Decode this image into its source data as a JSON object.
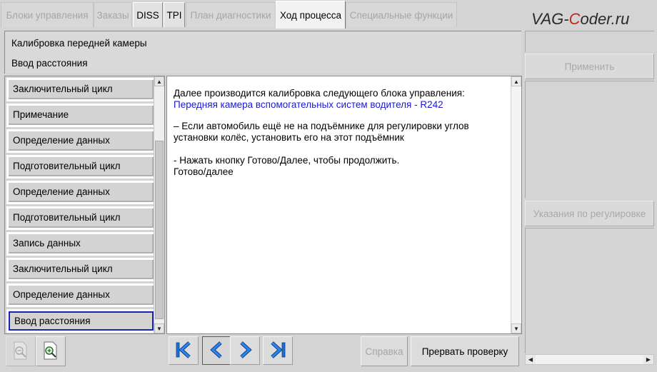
{
  "tabs": [
    {
      "label": "Блоки управления",
      "state": "disabled"
    },
    {
      "label": "Заказы",
      "state": "disabled"
    },
    {
      "label": "DISS",
      "state": "enabled"
    },
    {
      "label": "TPI",
      "state": "enabled"
    },
    {
      "label": "План диагностики",
      "state": "disabled"
    },
    {
      "label": "Ход процесса",
      "state": "active"
    },
    {
      "label": "Специальные функции",
      "state": "disabled"
    }
  ],
  "brand": {
    "prefix": "VAG-",
    "accent": "C",
    "suffix": "oder.ru",
    "accent_color": "#c0281e"
  },
  "header": {
    "title": "Калибровка передней камеры",
    "subtitle": "Ввод расстояния"
  },
  "steps": [
    {
      "label": "Заключительный цикл",
      "selected": false
    },
    {
      "label": "Примечание",
      "selected": false
    },
    {
      "label": "Определение данных",
      "selected": false
    },
    {
      "label": "Подготовительный цикл",
      "selected": false
    },
    {
      "label": "Определение данных",
      "selected": false
    },
    {
      "label": "Подготовительный цикл",
      "selected": false
    },
    {
      "label": "Запись данных",
      "selected": false
    },
    {
      "label": "Заключительный цикл",
      "selected": false
    },
    {
      "label": "Определение данных",
      "selected": false
    },
    {
      "label": "Ввод расстояния",
      "selected": true
    }
  ],
  "content": {
    "line1": "Далее производится калибровка следующего блока управления:",
    "line2": "Передняя камера вспомогательных систем водителя - R242",
    "line3": "– Если автомобиль ещё не на подъёмнике для регулировки углов",
    "line4": "установки колёс, установить его на этот подъёмник",
    "line5": "- Нажать кнопку Готово/Далее, чтобы продолжить.",
    "line6": "Готово/далее",
    "link_color": "#1b1bd2"
  },
  "right_panel": {
    "apply_label": "Применить",
    "adjust_label": "Указания по регулировке"
  },
  "bottom": {
    "zoom_out_icon": "zoom-out-icon",
    "zoom_in_icon": "zoom-in-icon",
    "first_icon": "skip-first-icon",
    "prev_icon": "chevron-left-icon",
    "next_icon": "chevron-right-icon",
    "last_icon": "skip-last-icon",
    "help_label": "Справка",
    "abort_label": "Прервать проверку"
  }
}
